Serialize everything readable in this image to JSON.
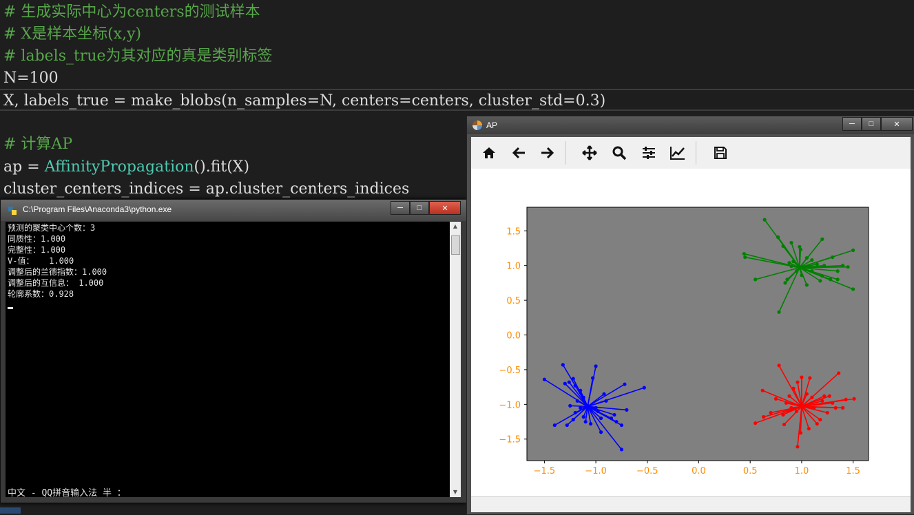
{
  "editor": {
    "lines": [
      "# 生成实际中心为centers的测试样本",
      "# X是样本坐标(x,y)",
      "# labels_true为其对应的真是类别标签",
      "N=100",
      "X, labels_true = make_blobs(n_samples=N, centers=centers, cluster_std=0.3)",
      "",
      "# 计算AP",
      "ap = ",
      "cluster_centers_indices = ap.cluster_centers_indices"
    ],
    "class_token": "AffinityPropagation",
    "class_rest": "().fit(X)"
  },
  "console": {
    "title": "C:\\Program Files\\Anaconda3\\python.exe",
    "lines": [
      "预测的聚类中心个数：3",
      "同质性：1.000",
      "完整性：1.000",
      "V-值：   1.000",
      "调整后的兰德指数：1.000",
      "调整后的互信息： 1.000",
      "轮廓系数：0.928"
    ],
    "ime_status": "中文 - QQ拼音输入法 半 ："
  },
  "figure": {
    "title": "AP",
    "toolbar": [
      "home-icon",
      "back-icon",
      "forward-icon",
      "pan-icon",
      "zoom-icon",
      "configure-subplots-icon",
      "edit-axis-icon",
      "save-icon"
    ],
    "colors": {
      "axes_bg": "#808080",
      "tick_label": "#ff8c00",
      "green": "#008000",
      "red": "#ff0000",
      "blue": "#0000ff"
    }
  },
  "chart_data": {
    "type": "scatter",
    "title": "",
    "xlabel": "",
    "ylabel": "",
    "xlim": [
      -1.67,
      1.65
    ],
    "ylim": [
      -1.81,
      1.84
    ],
    "xticks": [
      "−1.5",
      "−1.0",
      "−0.5",
      "0.0",
      "0.5",
      "1.0",
      "1.5"
    ],
    "yticks": [
      "1.5",
      "1.0",
      "0.5",
      "0.0",
      "−0.5",
      "−1.0",
      "−1.5"
    ],
    "xtick_values": [
      -1.5,
      -1.0,
      -0.5,
      0.0,
      0.5,
      1.0,
      1.5
    ],
    "ytick_values": [
      1.5,
      1.0,
      0.5,
      0.0,
      -0.5,
      -1.0,
      -1.5
    ],
    "grid": false,
    "clusters": [
      {
        "color": "#008000",
        "center": [
          0.98,
          0.97
        ],
        "points": [
          [
            0.64,
            1.66
          ],
          [
            0.82,
            1.28
          ],
          [
            0.77,
            1.41
          ],
          [
            0.9,
            1.33
          ],
          [
            0.98,
            1.27
          ],
          [
            0.99,
            1.23
          ],
          [
            1.2,
            1.38
          ],
          [
            0.44,
            1.17
          ],
          [
            0.45,
            1.12
          ],
          [
            0.55,
            0.8
          ],
          [
            0.78,
            0.33
          ],
          [
            0.84,
            0.75
          ],
          [
            0.86,
            0.8
          ],
          [
            0.9,
            0.99
          ],
          [
            1.0,
            0.86
          ],
          [
            1.05,
            0.72
          ],
          [
            1.18,
            0.78
          ],
          [
            1.28,
            0.8
          ],
          [
            1.4,
            1.0
          ],
          [
            1.45,
            0.98
          ],
          [
            1.5,
            1.22
          ],
          [
            1.5,
            0.66
          ],
          [
            1.35,
            0.8
          ],
          [
            1.3,
            1.12
          ],
          [
            1.22,
            1.0
          ],
          [
            1.1,
            1.08
          ],
          [
            1.05,
            1.11
          ],
          [
            0.92,
            1.06
          ],
          [
            0.88,
            1.04
          ],
          [
            0.95,
            0.92
          ],
          [
            1.1,
            0.92
          ],
          [
            1.15,
            1.02
          ],
          [
            1.35,
            0.92
          ],
          [
            1.2,
            0.85
          ]
        ]
      },
      {
        "color": "#ff0000",
        "center": [
          1.0,
          -1.03
        ],
        "points": [
          [
            0.78,
            -0.44
          ],
          [
            0.92,
            -0.77
          ],
          [
            0.96,
            -0.68
          ],
          [
            1.0,
            -0.61
          ],
          [
            1.08,
            -0.62
          ],
          [
            1.36,
            -0.55
          ],
          [
            1.51,
            -0.92
          ],
          [
            1.43,
            -0.93
          ],
          [
            1.4,
            -1.05
          ],
          [
            1.3,
            -0.98
          ],
          [
            1.25,
            -1.12
          ],
          [
            0.62,
            -0.8
          ],
          [
            0.85,
            -0.98
          ],
          [
            0.9,
            -1.05
          ],
          [
            0.95,
            -1.1
          ],
          [
            0.55,
            -1.27
          ],
          [
            0.63,
            -1.18
          ],
          [
            0.7,
            -1.12
          ],
          [
            0.83,
            -1.29
          ],
          [
            0.99,
            -1.41
          ],
          [
            0.96,
            -1.61
          ],
          [
            1.07,
            -1.35
          ],
          [
            1.15,
            -1.28
          ],
          [
            1.18,
            -1.22
          ],
          [
            1.1,
            -0.9
          ],
          [
            1.2,
            -0.95
          ],
          [
            1.05,
            -0.85
          ],
          [
            0.75,
            -0.92
          ],
          [
            0.88,
            -0.88
          ],
          [
            1.12,
            -1.05
          ],
          [
            1.22,
            -0.88
          ],
          [
            0.82,
            -1.15
          ],
          [
            1.33,
            -1.05
          ],
          [
            1.27,
            -0.88
          ]
        ]
      },
      {
        "color": "#0000ff",
        "center": [
          -1.08,
          -1.03
        ],
        "points": [
          [
            -1.5,
            -0.64
          ],
          [
            -1.32,
            -0.43
          ],
          [
            -1.26,
            -0.68
          ],
          [
            -1.22,
            -0.63
          ],
          [
            -1.3,
            -0.7
          ],
          [
            -1.2,
            -0.73
          ],
          [
            -1.15,
            -0.8
          ],
          [
            -1.12,
            -0.9
          ],
          [
            -1.0,
            -0.45
          ],
          [
            -1.03,
            -0.62
          ],
          [
            -0.92,
            -0.85
          ],
          [
            -0.72,
            -0.71
          ],
          [
            -0.53,
            -0.76
          ],
          [
            -1.4,
            -1.3
          ],
          [
            -1.28,
            -1.3
          ],
          [
            -1.22,
            -1.22
          ],
          [
            -1.15,
            -1.05
          ],
          [
            -1.1,
            -1.25
          ],
          [
            -1.05,
            -1.28
          ],
          [
            -0.95,
            -1.2
          ],
          [
            -0.85,
            -1.2
          ],
          [
            -0.8,
            -1.25
          ],
          [
            -0.75,
            -1.3
          ],
          [
            -0.82,
            -1.15
          ],
          [
            -0.7,
            -1.08
          ],
          [
            -0.75,
            -1.65
          ],
          [
            -0.98,
            -1.1
          ],
          [
            -1.18,
            -0.95
          ],
          [
            -1.25,
            -1.02
          ],
          [
            -0.9,
            -0.95
          ],
          [
            -1.12,
            -1.18
          ],
          [
            -0.95,
            -1.4
          ],
          [
            -1.0,
            -1.05
          ],
          [
            -1.2,
            -1.12
          ]
        ]
      }
    ]
  }
}
